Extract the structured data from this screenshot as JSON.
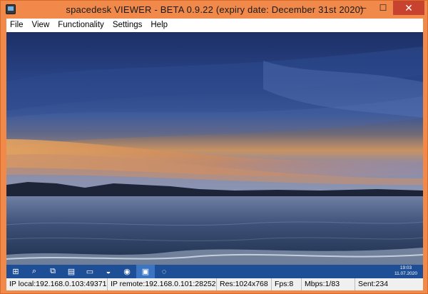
{
  "window": {
    "title": "spacedesk VIEWER - BETA 0.9.22 (expiry date: December 31st 2020)",
    "controls": {
      "minimize": "─",
      "maximize": "☐",
      "close": "✕"
    }
  },
  "menu": [
    "File",
    "View",
    "Functionality",
    "Settings",
    "Help"
  ],
  "remote_taskbar": {
    "items": [
      {
        "name": "start-icon",
        "glyph": "⊞"
      },
      {
        "name": "search-icon",
        "glyph": "⌕"
      },
      {
        "name": "task-view-icon",
        "glyph": "⧉"
      },
      {
        "name": "notepad-icon",
        "glyph": "▤"
      },
      {
        "name": "file-explorer-icon",
        "glyph": "▭"
      },
      {
        "name": "edge-browser-icon",
        "glyph": "◒"
      },
      {
        "name": "chrome-browser-icon",
        "glyph": "◉"
      },
      {
        "name": "spacedesk-icon",
        "glyph": "▣"
      },
      {
        "name": "app-icon",
        "glyph": "◌"
      }
    ],
    "clock_time": "19:03",
    "clock_date": "11.07.2020"
  },
  "status": {
    "ip_local": "IP local:192.168.0.103:49371",
    "ip_remote": "IP remote:192.168.0.101:28252",
    "res": "Res:1024x768",
    "fps": "Fps:8",
    "mbps": "Mbps:1/83",
    "sent": "Sent:234"
  },
  "colors": {
    "frame": "#f0894a",
    "taskbar": "#1e4f96",
    "close_button": "#c7432f"
  }
}
